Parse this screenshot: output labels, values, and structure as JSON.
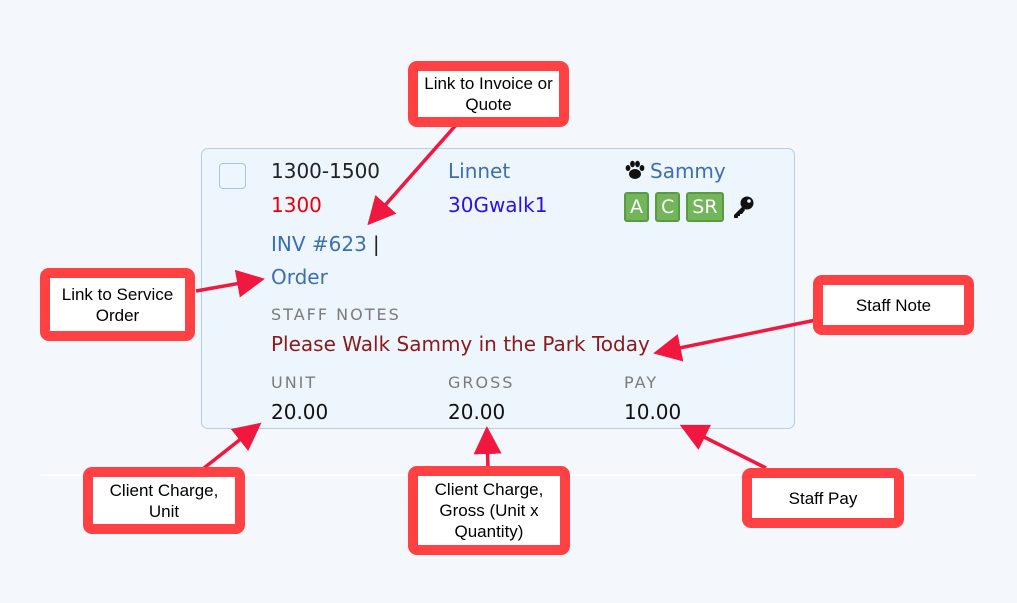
{
  "card": {
    "time_range": "1300-1500",
    "start_time": "1300",
    "invoice_link": "INV #623",
    "separator": "|",
    "order_link": "Order",
    "client_name": "Linnet",
    "service_code": "30Gwalk1",
    "pet_icon": "paw-icon",
    "pet_name": "Sammy",
    "badges": [
      "A",
      "C",
      "SR"
    ],
    "key_icon": "key-icon",
    "staff_notes_label": "STAFF NOTES",
    "staff_note": "Please Walk Sammy in the Park Today",
    "unit_label": "UNIT",
    "unit_value": "20.00",
    "gross_label": "GROSS",
    "gross_value": "20.00",
    "pay_label": "PAY",
    "pay_value": "10.00"
  },
  "callouts": {
    "invoice": "Link to Invoice or Quote",
    "service_order": "Link to Service Order",
    "staff_note": "Staff Note",
    "unit": "Client Charge, Unit",
    "gross": "Client Charge, Gross (Unit x Quantity)",
    "pay": "Staff Pay"
  },
  "colors": {
    "callout_border": "#ff4144",
    "arrow": "#f0183f",
    "link": "#3d6fb0",
    "start_time": "#e8000b",
    "service_code": "#2b10e8",
    "note": "#8b1a1a",
    "badge": "#73b55a"
  }
}
